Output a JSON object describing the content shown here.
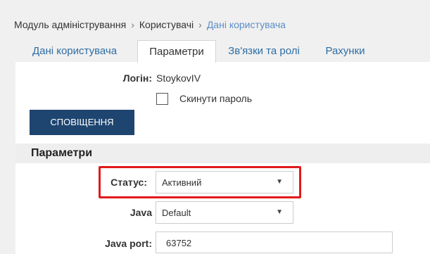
{
  "breadcrumb": {
    "items": [
      "Модуль адміністрування",
      "Користувачі",
      "Дані користувача"
    ],
    "separator": "›"
  },
  "tabs": [
    {
      "label": "Дані користувача",
      "active": false
    },
    {
      "label": "Параметри",
      "active": true
    },
    {
      "label": "Зв'язки та ролі",
      "active": false
    },
    {
      "label": "Рахунки",
      "active": false
    }
  ],
  "form": {
    "login_label": "Логін:",
    "login_value": "StoykovIV",
    "reset_password_label": "Скинути пароль",
    "reset_password_checked": false,
    "notifications_button": "СПОВІЩЕННЯ",
    "section_title": "Параметри",
    "status_label": "Статус:",
    "status_value": "Активний",
    "java_label": "Java",
    "java_value": "Default",
    "java_port_label": "Java port:",
    "java_port_value": "63752"
  },
  "icons": {
    "dropdown": "caret-down-icon"
  },
  "colors": {
    "accent_link": "#2e6da4",
    "breadcrumb_current": "#5b8ec7",
    "button_bg": "#1e4570",
    "highlight": "#e3191b"
  }
}
